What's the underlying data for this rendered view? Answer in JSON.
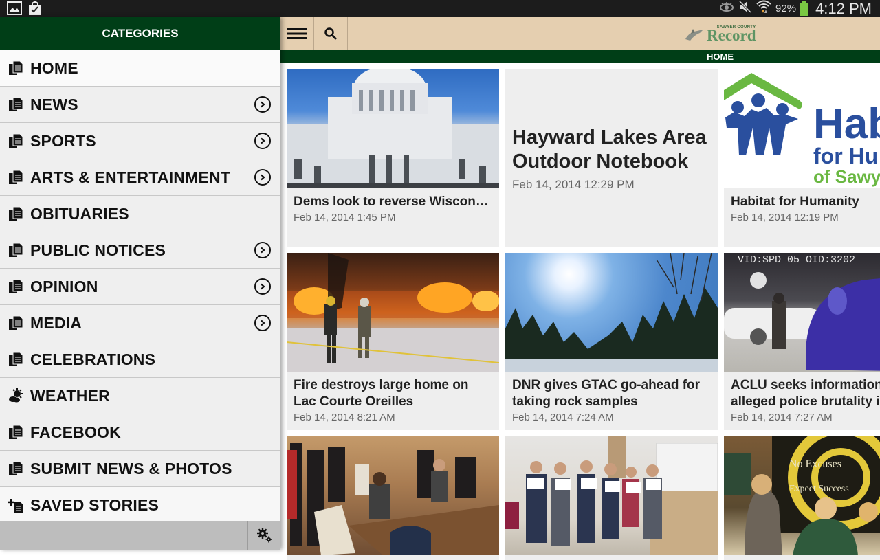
{
  "status_bar": {
    "battery_percent": "92%",
    "time": "4:12 PM",
    "left_icons": [
      "gallery-notification-icon",
      "shopping-bag-icon"
    ],
    "right_icons": [
      "eye-icon",
      "mute-icon",
      "wifi-icon",
      "battery-icon"
    ]
  },
  "drawer": {
    "title": "CATEGORIES",
    "items": [
      {
        "label": "HOME",
        "icon": "documents-icon",
        "has_arrow": false,
        "active": true
      },
      {
        "label": "NEWS",
        "icon": "documents-icon",
        "has_arrow": true
      },
      {
        "label": "SPORTS",
        "icon": "documents-icon",
        "has_arrow": true
      },
      {
        "label": "ARTS & ENTERTAINMENT",
        "icon": "documents-icon",
        "has_arrow": true
      },
      {
        "label": "OBITUARIES",
        "icon": "documents-icon",
        "has_arrow": false
      },
      {
        "label": "PUBLIC NOTICES",
        "icon": "documents-icon",
        "has_arrow": true
      },
      {
        "label": "OPINION",
        "icon": "documents-icon",
        "has_arrow": true
      },
      {
        "label": "MEDIA",
        "icon": "documents-icon",
        "has_arrow": true
      },
      {
        "label": "CELEBRATIONS",
        "icon": "documents-icon",
        "has_arrow": false
      },
      {
        "label": "WEATHER",
        "icon": "weather-icon",
        "has_arrow": false
      },
      {
        "label": "FACEBOOK",
        "icon": "documents-icon",
        "has_arrow": false
      },
      {
        "label": "SUBMIT NEWS & PHOTOS",
        "icon": "documents-icon",
        "has_arrow": false
      },
      {
        "label": "SAVED STORIES",
        "icon": "add-document-icon",
        "has_arrow": false
      }
    ]
  },
  "header": {
    "logo_small": "SAWYER COUNTY",
    "logo_big": "Record",
    "section": "HOME"
  },
  "articles": [
    {
      "title": "Dems look to reverse Wisconsin's constitutional ban...",
      "date": "Feb 14, 2014 1:45 PM",
      "image": "capitol-building-photo"
    },
    {
      "title": "Hayward Lakes Area Outdoor Notebook",
      "date": "Feb 14, 2014 12:29 PM",
      "image": null
    },
    {
      "title": "Habitat for Humanity",
      "date": "Feb 14, 2014 12:19 PM",
      "image": "habitat-logo",
      "image_text": [
        "Hab",
        "for Hu",
        "of Sawy"
      ]
    },
    {
      "title": "Fire destroys large home on Lac Courte Oreilles",
      "date": "Feb 14, 2014 8:21 AM",
      "image": "house-fire-photo"
    },
    {
      "title": "DNR gives GTAC go-ahead for taking rock samples",
      "date": "Feb 14, 2014 7:24 AM",
      "image": "winter-forest-sun-photo"
    },
    {
      "title": "ACLU seeks information alleged police brutality in...",
      "title_lines": [
        "ACLU seeks information",
        "alleged police brutality in"
      ],
      "date": "Feb 14, 2014 7:27 AM",
      "image": "police-dashcam-photo",
      "image_text": "VID:SPD 05 OID:3202"
    },
    {
      "title": "",
      "date": "",
      "image": "committee-hearing-photo"
    },
    {
      "title": "",
      "date": "",
      "image": "students-certificates-photo"
    },
    {
      "title": "",
      "date": "",
      "image": "signing-day-photo",
      "image_text": [
        "No Excuses",
        "Expect Success"
      ]
    }
  ]
}
